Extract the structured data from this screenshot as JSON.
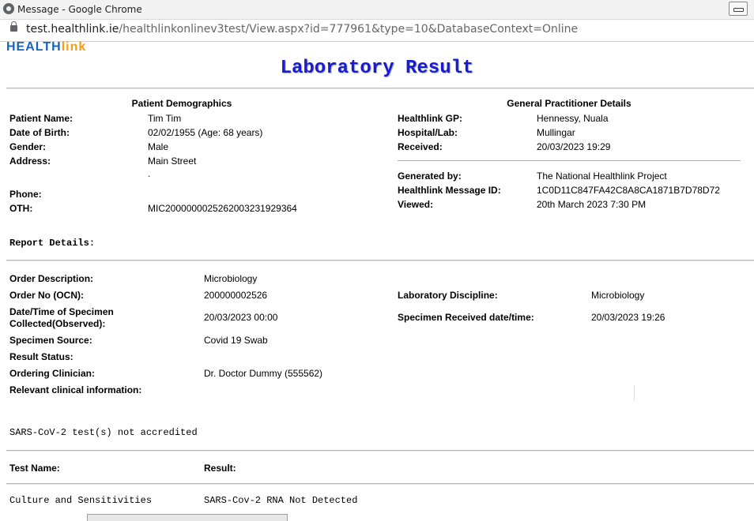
{
  "window": {
    "title": "Message - Google Chrome"
  },
  "address": {
    "host": "test.healthlink.ie",
    "path": "/healthlinkonlinev3test/View.aspx?id=777961&type=10&DatabaseContext=Online"
  },
  "logo": {
    "text_a": "HEALTH",
    "text_b": "link"
  },
  "page_title": "Laboratory Result",
  "patient": {
    "heading": "Patient Demographics",
    "name_label": "Patient Name:",
    "name": "Tim Tim",
    "dob_label": "Date of Birth:",
    "dob": "02/02/1955 (Age: 68 years)",
    "gender_label": "Gender:",
    "gender": "Male",
    "address_label": "Address:",
    "address": "Main Street",
    "address2": ".",
    "phone_label": "Phone:",
    "phone": "",
    "oth_label": "OTH:",
    "oth": "MIC2000000025262003231929364"
  },
  "gp": {
    "heading": "General Practitioner Details",
    "gp_label": "Healthlink GP:",
    "gp": "Hennessy, Nuala",
    "hospital_label": "Hospital/Lab:",
    "hospital": "Mullingar",
    "received_label": "Received:",
    "received": "20/03/2023 19:29",
    "generated_label": "Generated by:",
    "generated": "The National Healthlink Project",
    "msgid_label": "Healthlink Message ID:",
    "msgid": "1C0D11C847FA42C8A8CA1871B7D78D72",
    "viewed_label": "Viewed:",
    "viewed": "20th March 2023 7:30 PM"
  },
  "report": {
    "heading": "Report Details:",
    "order_desc_label": "Order Description:",
    "order_desc": "Microbiology",
    "order_no_label": "Order No (OCN):",
    "order_no": "200000002526",
    "lab_disc_label": "Laboratory Discipline:",
    "lab_disc": "Microbiology",
    "collected_label_1": "Date/Time of Specimen",
    "collected_label_2": "Collected(Observed):",
    "collected": "20/03/2023 00:00",
    "spec_received_label": "Specimen Received date/time:",
    "spec_received": "20/03/2023 19:26",
    "source_label": "Specimen Source:",
    "source": "Covid 19 Swab",
    "status_label": "Result Status:",
    "status": "",
    "clinician_label": "Ordering Clinician:",
    "clinician": "Dr. Doctor Dummy (555562)",
    "clinical_info_label": "Relevant clinical information:",
    "clinical_info": ""
  },
  "note": "SARS-CoV-2 test(s) not accredited",
  "results": {
    "col_test": "Test Name:",
    "col_result": "Result:",
    "rows": [
      {
        "test": "Culture and Sensitivities",
        "result": "SARS-Cov-2 RNA Not Detected"
      }
    ]
  }
}
